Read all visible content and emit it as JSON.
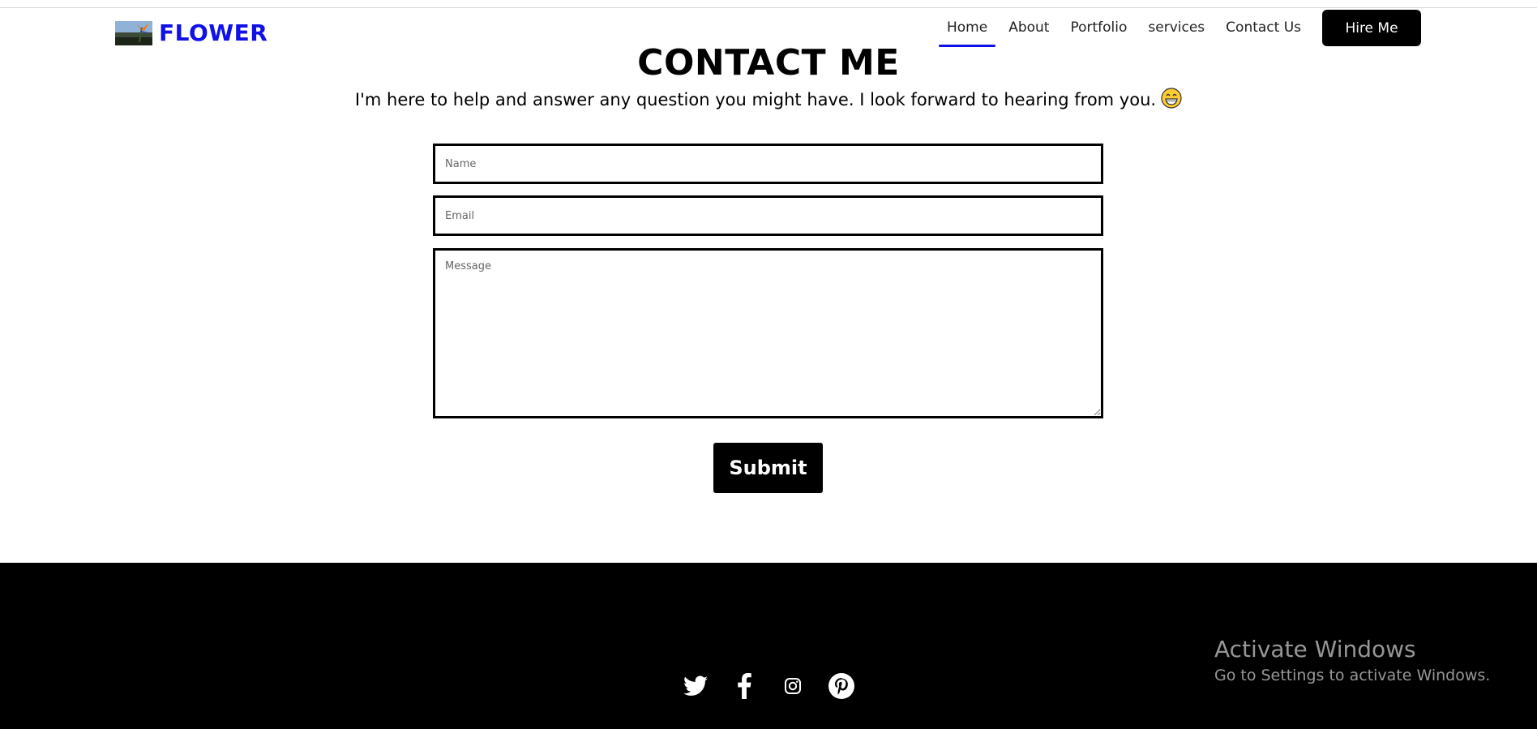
{
  "brand": {
    "name": "FLOWER",
    "color": "#1010e8"
  },
  "nav": {
    "items": [
      {
        "label": "Home",
        "active": true
      },
      {
        "label": "About",
        "active": false
      },
      {
        "label": "Portfolio",
        "active": false
      },
      {
        "label": "services",
        "active": false
      },
      {
        "label": "Contact Us",
        "active": false
      }
    ],
    "hire_label": "Hire Me"
  },
  "contact": {
    "title": "CONTACT ME",
    "subtitle": "I'm here to help and answer any question you might have. I look forward to hearing from you.",
    "subtitle_emoji": "grinning-face-emoji",
    "form": {
      "name_placeholder": "Name",
      "email_placeholder": "Email",
      "message_placeholder": "Message",
      "submit_label": "Submit"
    }
  },
  "footer": {
    "socials": [
      "twitter-icon",
      "facebook-icon",
      "instagram-icon",
      "pinterest-icon"
    ]
  },
  "watermark": {
    "line1": "Activate Windows",
    "line2": "Go to Settings to activate Windows."
  }
}
